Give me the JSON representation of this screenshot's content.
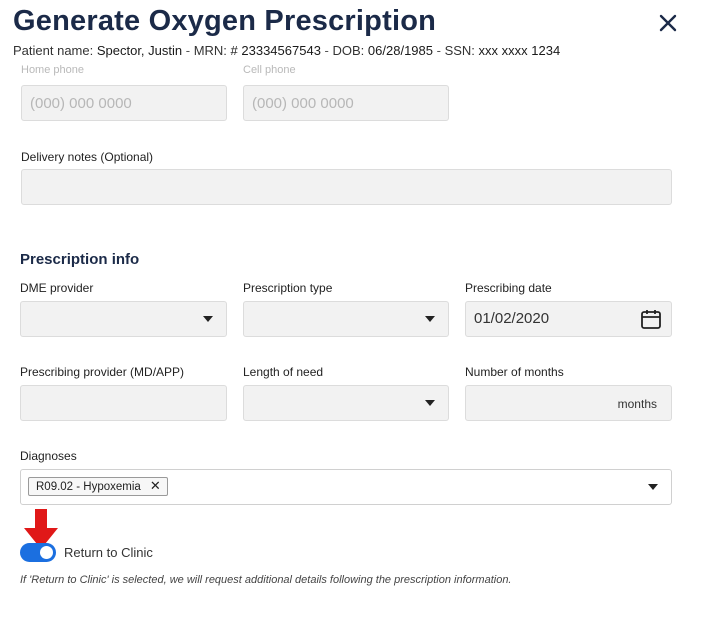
{
  "header": {
    "title": "Generate Oxygen Prescription",
    "patient": {
      "name_label": "Patient name:",
      "name": "Spector, Justin",
      "mrn_label": "MRN:",
      "mrn": "# 23334567543",
      "dob_label": "DOB:",
      "dob": "06/28/1985",
      "ssn_label": "SSN:",
      "ssn": "xxx xxxx 1234"
    }
  },
  "contact": {
    "home_phone_label": "Home phone",
    "home_phone_placeholder": "(000) 000 0000",
    "cell_phone_label": "Cell phone",
    "cell_phone_placeholder": "(000) 000 0000"
  },
  "delivery": {
    "label": "Delivery notes (Optional)",
    "value": ""
  },
  "prescription": {
    "section_title": "Prescription info",
    "dme_label": "DME provider",
    "type_label": "Prescription type",
    "date_label": "Prescribing date",
    "date_value": "01/02/2020",
    "provider_label": "Prescribing provider (MD/APP)",
    "length_label": "Length of need",
    "months_label": "Number of months",
    "months_suffix": "months",
    "diagnoses_label": "Diagnoses",
    "diagnosis_chip": "R09.02 - Hypoxemia"
  },
  "return_to_clinic": {
    "label": "Return to Clinic",
    "enabled": true,
    "note": "If 'Return to Clinic' is selected, we will request additional details following the prescription information."
  },
  "colors": {
    "title": "#1b2a48",
    "toggle": "#1b6fe0",
    "annotation_arrow": "#e01818"
  },
  "icons": [
    "close-icon",
    "chevron-down-icon",
    "calendar-icon",
    "remove-chip-icon",
    "red-arrow-annotation"
  ]
}
